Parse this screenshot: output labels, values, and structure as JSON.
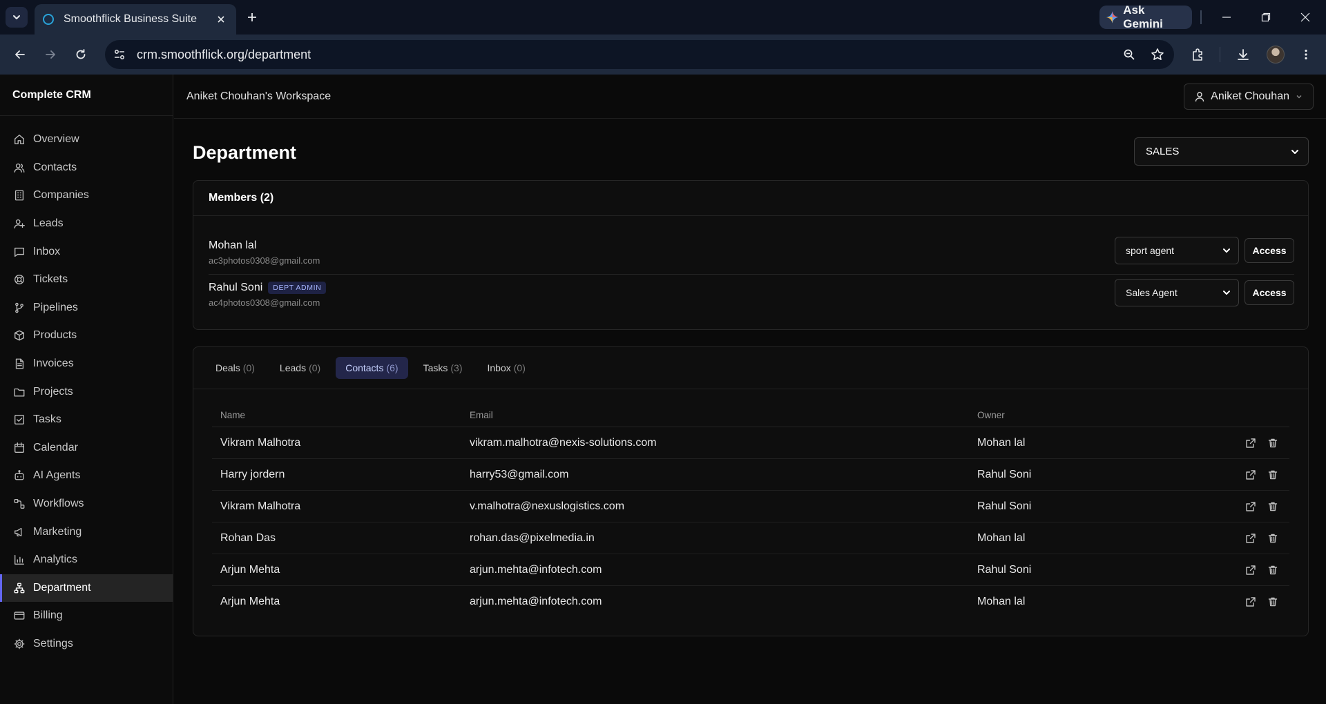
{
  "browser": {
    "tab_title": "Smoothflick Business Suite",
    "url": "crm.smoothflick.org/department",
    "gemini_label": "Ask Gemini"
  },
  "sidebar": {
    "brand": "Complete CRM",
    "items": [
      {
        "label": "Overview",
        "icon": "home-icon"
      },
      {
        "label": "Contacts",
        "icon": "users-icon"
      },
      {
        "label": "Companies",
        "icon": "building-icon"
      },
      {
        "label": "Leads",
        "icon": "user-plus-icon"
      },
      {
        "label": "Inbox",
        "icon": "message-icon"
      },
      {
        "label": "Tickets",
        "icon": "lifebuoy-icon"
      },
      {
        "label": "Pipelines",
        "icon": "git-branch-icon"
      },
      {
        "label": "Products",
        "icon": "package-icon"
      },
      {
        "label": "Invoices",
        "icon": "file-text-icon"
      },
      {
        "label": "Projects",
        "icon": "folder-icon"
      },
      {
        "label": "Tasks",
        "icon": "check-square-icon"
      },
      {
        "label": "Calendar",
        "icon": "calendar-icon"
      },
      {
        "label": "AI Agents",
        "icon": "bot-icon"
      },
      {
        "label": "Workflows",
        "icon": "workflow-icon"
      },
      {
        "label": "Marketing",
        "icon": "megaphone-icon"
      },
      {
        "label": "Analytics",
        "icon": "bar-chart-icon"
      },
      {
        "label": "Department",
        "icon": "network-icon",
        "active": true
      },
      {
        "label": "Billing",
        "icon": "credit-card-icon"
      },
      {
        "label": "Settings",
        "icon": "gear-icon"
      }
    ]
  },
  "header": {
    "workspace": "Aniket Chouhan's Workspace",
    "user_name": "Aniket Chouhan"
  },
  "page": {
    "title": "Department",
    "department_selected": "SALES"
  },
  "members": {
    "heading": "Members (2)",
    "list": [
      {
        "name": "Mohan lal",
        "email": "ac3photos0308@gmail.com",
        "badge": "",
        "role": "sport agent",
        "access_label": "Access"
      },
      {
        "name": "Rahul Soni",
        "email": "ac4photos0308@gmail.com",
        "badge": "DEPT ADMIN",
        "role": "Sales Agent",
        "access_label": "Access"
      }
    ]
  },
  "records": {
    "tabs": [
      {
        "label": "Deals",
        "count": "(0)"
      },
      {
        "label": "Leads",
        "count": "(0)"
      },
      {
        "label": "Contacts",
        "count": "(6)",
        "active": true
      },
      {
        "label": "Tasks",
        "count": "(3)"
      },
      {
        "label": "Inbox",
        "count": "(0)"
      }
    ],
    "columns": {
      "name": "Name",
      "email": "Email",
      "owner": "Owner"
    },
    "rows": [
      {
        "name": "Vikram Malhotra",
        "email": "vikram.malhotra@nexis-solutions.com",
        "owner": "Mohan lal"
      },
      {
        "name": "Harry jordern",
        "email": "harry53@gmail.com",
        "owner": "Rahul Soni"
      },
      {
        "name": "Vikram Malhotra",
        "email": "v.malhotra@nexuslogistics.com",
        "owner": "Rahul Soni"
      },
      {
        "name": "Rohan Das",
        "email": "rohan.das@pixelmedia.in",
        "owner": "Mohan lal"
      },
      {
        "name": "Arjun Mehta",
        "email": "arjun.mehta@infotech.com",
        "owner": "Rahul Soni"
      },
      {
        "name": "Arjun Mehta",
        "email": "arjun.mehta@infotech.com",
        "owner": "Mohan lal"
      }
    ]
  },
  "colors": {
    "accent": "#6366f1",
    "active_tab_bg": "#23264a",
    "badge_text": "#a5b4fc"
  }
}
